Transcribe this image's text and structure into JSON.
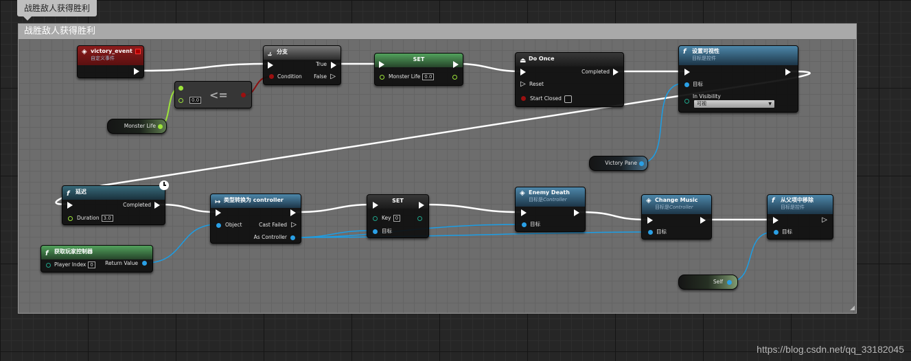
{
  "tab": {
    "title": "战胜敌人获得胜利"
  },
  "comment": {
    "title": "战胜敌人获得胜利"
  },
  "nodes": {
    "victory_event": {
      "title": "victory_event",
      "subtitle": "自定义事件"
    },
    "branch": {
      "title": "分支",
      "condition": "Condition",
      "true_label": "True",
      "false_label": "False"
    },
    "compare": {
      "operator": "<=",
      "value": "0.0"
    },
    "monster_life_get": {
      "label": "Monster Life"
    },
    "set_monster_life": {
      "title": "SET",
      "pin_label": "Monster Life",
      "value": "0.0"
    },
    "do_once": {
      "title": "Do Once",
      "completed": "Completed",
      "reset": "Reset",
      "start_closed": "Start Closed"
    },
    "set_visibility": {
      "title": "设置可视性",
      "subtitle": "目标是控件",
      "target": "目标",
      "in_visibility": "In Visibility",
      "visibility_value": "可视"
    },
    "victory_pane_get": {
      "label": "Victory Pane"
    },
    "delay": {
      "title": "延迟",
      "completed": "Completed",
      "duration": "Duration",
      "duration_value": "3.0"
    },
    "cast": {
      "title": "类型转换为 controller",
      "object": "Object",
      "cast_failed": "Cast Failed",
      "as_controller": "As Controller"
    },
    "get_player_controller": {
      "title": "获取玩家控制器",
      "player_index": "Player Index",
      "player_index_value": "0",
      "return_value": "Return Value"
    },
    "set_key": {
      "title": "SET",
      "key": "Key",
      "key_value": "0",
      "target": "目标"
    },
    "enemy_death": {
      "title": "Enemy Death",
      "subtitle_prefix": "目标是",
      "subtitle_class": "Controller",
      "target": "目标"
    },
    "change_music": {
      "title": "Change Music",
      "subtitle_prefix": "目标是",
      "subtitle_class": "Controller",
      "target": "目标"
    },
    "remove_from_parent": {
      "title": "从父项中移除",
      "subtitle": "目标是控件",
      "target": "目标"
    },
    "self_ref": {
      "label": "Self"
    }
  },
  "watermark": "https://blog.csdn.net/qq_33182045",
  "colors": {
    "exec_wire": "#ffffff",
    "bool_wire": "#8b1010",
    "float_wire": "#9de43a",
    "object_wire": "#1b9ee6"
  },
  "icons": {
    "event": "diamond-event-icon",
    "branch": "branch-icon",
    "function": "function-f-icon",
    "do_once": "do-once-icon",
    "cast": "cast-arrow-icon",
    "latent": "clock-icon"
  }
}
